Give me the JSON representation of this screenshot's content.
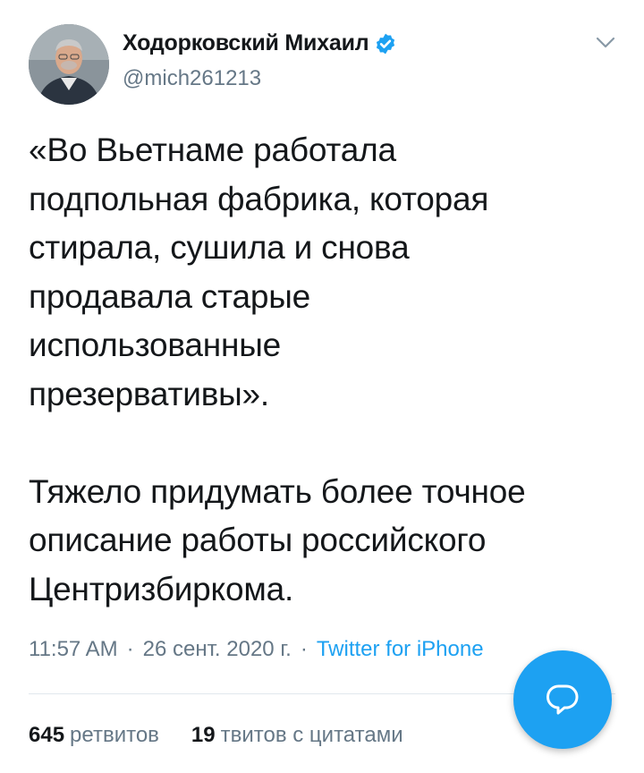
{
  "author": {
    "display_name": "Ходорковский Михаил",
    "handle": "@mich261213",
    "verified": true,
    "avatar_icon": "user-photo-avatar"
  },
  "tweet": {
    "lines": [
      "«Во Вьетнаме работала",
      "подпольная фабрика, которая",
      "стирала, сушила и снова",
      "продавала старые",
      "использованные",
      "презервативы».",
      "",
      "Тяжело придумать более точное",
      "описание работы российского",
      "Центризбиркома."
    ]
  },
  "meta": {
    "time": "11:57 AM",
    "separator": "·",
    "date": "26 сент. 2020 г.",
    "source": "Twitter for iPhone"
  },
  "stats": {
    "retweets_count": "645",
    "retweets_label": "ретвитов",
    "quotes_count": "19",
    "quotes_label": "твитов с цитатами"
  },
  "icons": {
    "verified": "verified-badge-icon",
    "more": "chevron-down-icon",
    "compose": "reply-bubble-icon"
  },
  "colors": {
    "accent": "#1da1f2",
    "text": "#14171a",
    "secondary": "#657786",
    "divider": "#e1e8ed"
  }
}
